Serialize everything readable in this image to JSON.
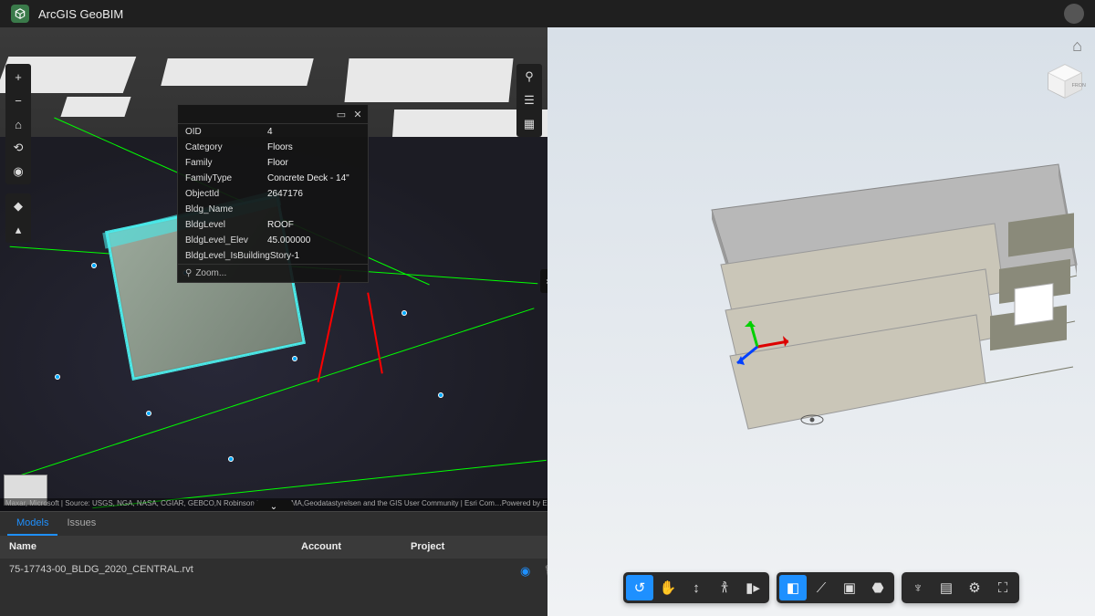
{
  "app_title": "ArcGIS GeoBIM",
  "left_tools": [
    {
      "name": "zoom-in-icon",
      "glyph": "+"
    },
    {
      "name": "zoom-out-icon",
      "glyph": "−"
    },
    {
      "name": "home-icon",
      "glyph": "⌂"
    },
    {
      "name": "rotate-icon",
      "glyph": "⟲"
    },
    {
      "name": "compass-icon",
      "glyph": "◉"
    }
  ],
  "left_tools2": [
    {
      "name": "color-icon",
      "glyph": "◆"
    },
    {
      "name": "cursor-icon",
      "glyph": "▴"
    }
  ],
  "right_tools": [
    {
      "name": "search-icon",
      "glyph": "⚲"
    },
    {
      "name": "layers-icon",
      "glyph": "☰"
    },
    {
      "name": "basemap-icon",
      "glyph": "▦"
    }
  ],
  "popup": {
    "rows": [
      {
        "k": "OID",
        "v": "4"
      },
      {
        "k": "Category",
        "v": "Floors"
      },
      {
        "k": "Family",
        "v": "Floor"
      },
      {
        "k": "FamilyType",
        "v": "Concrete Deck - 14\""
      },
      {
        "k": "ObjectId",
        "v": "2647176"
      },
      {
        "k": "Bldg_Name",
        "v": ""
      },
      {
        "k": "BldgLevel",
        "v": "ROOF"
      },
      {
        "k": "BldgLevel_Elev",
        "v": "45.000000"
      },
      {
        "k": "BldgLevel_IsBuildingStory",
        "v": "-1"
      }
    ],
    "zoom_label": "Zoom..."
  },
  "attribution_left": "Maxar, Microsoft | Source: USGS, NGA, NASA, CGIAR, GEBCO,N Robinson,NCEAS,…MA,Geodatastyrelsen and the GIS User Community | Esri Com…",
  "attribution_right": "Powered by Esri",
  "panel": {
    "tabs": [
      {
        "label": "Models",
        "active": true
      },
      {
        "label": "Issues",
        "active": false
      }
    ],
    "columns": {
      "name": "Name",
      "account": "Account",
      "project": "Project"
    },
    "rows": [
      {
        "name": "75-17743-00_BLDG_2020_CENTRAL.rvt",
        "account": "",
        "project": ""
      }
    ]
  },
  "bim_toolbar": [
    [
      {
        "name": "orbit-icon",
        "glyph": "↺",
        "active": true
      },
      {
        "name": "pan-icon",
        "glyph": "✋"
      },
      {
        "name": "dolly-icon",
        "glyph": "↕"
      },
      {
        "name": "walk-icon",
        "glyph": "𐀪"
      },
      {
        "name": "camera-icon",
        "glyph": "▮▸"
      }
    ],
    [
      {
        "name": "section-icon",
        "glyph": "◧",
        "active": true
      },
      {
        "name": "measure-icon",
        "glyph": "⟋"
      },
      {
        "name": "explode-icon",
        "glyph": "▣"
      },
      {
        "name": "model-browser-icon",
        "glyph": "⬣"
      }
    ],
    [
      {
        "name": "tree-icon",
        "glyph": "♆"
      },
      {
        "name": "properties-icon",
        "glyph": "▤"
      },
      {
        "name": "settings-icon",
        "glyph": "⚙"
      },
      {
        "name": "fullscreen-icon",
        "glyph": "⛶"
      }
    ]
  ]
}
